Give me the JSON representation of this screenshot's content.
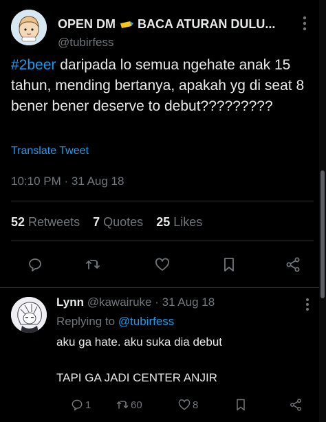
{
  "tweet": {
    "display_name": "OPEN DM",
    "display_name_rest": "BACA ATURAN DULU...",
    "handle": "@tubirfess",
    "hashtag": "#2beer",
    "text_after_hashtag": " daripada lo semua ngehate anak 15 tahun, mending bertanya, apakah yg di seat 8 bener bener deserve to debut?????????",
    "translate_label": "Translate Tweet",
    "timestamp": "10:10 PM · 31 Aug 18",
    "stats": {
      "retweets_count": "52",
      "retweets_label": "Retweets",
      "quotes_count": "7",
      "quotes_label": "Quotes",
      "likes_count": "25",
      "likes_label": "Likes"
    }
  },
  "reply": {
    "name": "Lynn",
    "handle_date": "@kawairuke · 31 Aug 18",
    "replying_prefix": "Replying to",
    "replying_to": "@tubirfess",
    "line1": "aku ga hate. aku suka dia debut",
    "line2": "TAPI GA JADI CENTER ANJIR",
    "reply_count": "1",
    "retweet_count": "60",
    "like_count": "8"
  },
  "colors": {
    "background": "#000000",
    "text": "#e7e9ea",
    "muted": "#71767b",
    "accent": "#1d9bf0",
    "divider": "#2f3336"
  },
  "icons": {
    "reply": "speech-bubble-icon",
    "retweet": "retweet-icon",
    "like": "heart-icon",
    "bookmark": "bookmark-icon",
    "share": "share-icon",
    "more": "more-vertical-icon"
  }
}
